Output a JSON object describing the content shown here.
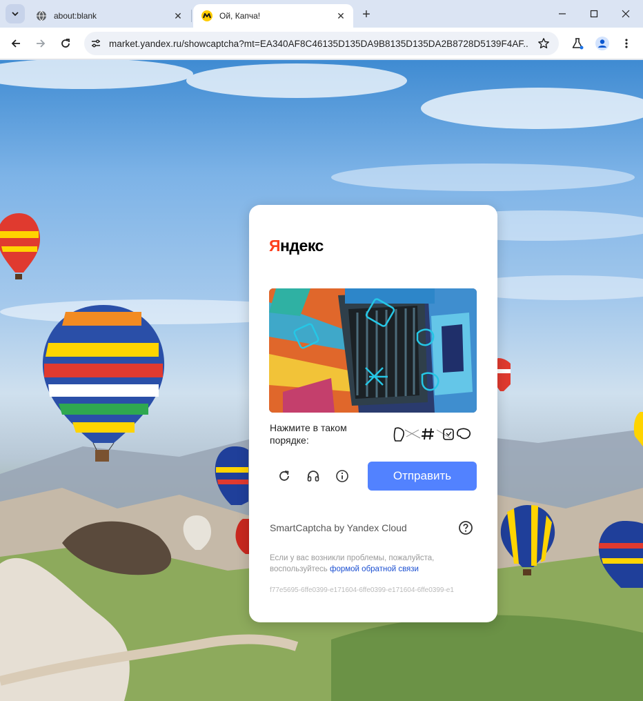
{
  "browser": {
    "tabs": [
      {
        "title": "about:blank",
        "active": false,
        "icon": "globe-icon"
      },
      {
        "title": "Ой, Капча!",
        "active": true,
        "icon": "yandex-market-icon"
      }
    ],
    "url": "market.yandex.ru/showcaptcha?mt=EA340AF8C46135D135DA9B8135D135DA2B8728D5139F4AF...",
    "icons": [
      "back-icon",
      "forward-icon",
      "reload-icon",
      "site-settings-icon",
      "star-icon",
      "labs-icon",
      "profile-icon",
      "menu-icon",
      "minimize-icon",
      "maximize-icon",
      "close-icon"
    ]
  },
  "captcha": {
    "logo": {
      "first": "Я",
      "rest": "ндекс"
    },
    "prompt": "Нажмите в таком порядке:",
    "submit_label": "Отправить",
    "brand": "SmartCaptcha by Yandex Cloud",
    "note_text": "Если у вас возникли проблемы, пожалуйста, воспользуйтесь ",
    "note_link": "формой обратной связи",
    "hash": "f77e5695-6ffe0399-e171604-6ffe0399-e171604-6ffe0399-e1",
    "accent": "#5282ff",
    "logo_color": "#fc3f1d"
  }
}
